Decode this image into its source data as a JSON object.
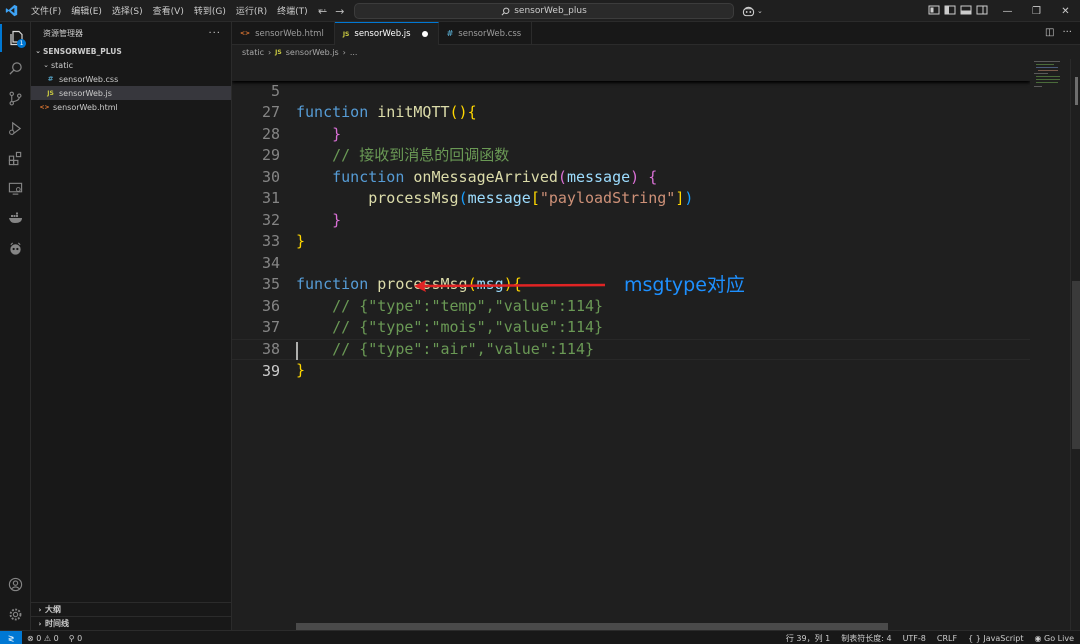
{
  "app": {
    "menu": [
      "文件(F)",
      "编辑(E)",
      "选择(S)",
      "查看(V)",
      "转到(G)",
      "运行(R)",
      "终端(T)",
      "···"
    ],
    "search_text": "sensorWeb_plus",
    "accent_color": "#0078d4"
  },
  "activity": {
    "explorer_badge": "1",
    "icons": [
      "files-icon",
      "search-icon",
      "source-control-icon",
      "run-debug-icon",
      "extensions-icon",
      "remote-explorer-icon",
      "docker-icon",
      "copilot-icon",
      "account-icon",
      "settings-gear-icon"
    ]
  },
  "sidebar": {
    "title": "资源管理器",
    "more": "···",
    "root": "SENSORWEB_PLUS",
    "folder": "static",
    "files": [
      {
        "name": "sensorWeb.css",
        "type": "css"
      },
      {
        "name": "sensorWeb.js",
        "type": "js"
      }
    ],
    "root_file": "sensorWeb.html",
    "outline_label": "大纲",
    "timeline_label": "时间线"
  },
  "tabs": [
    {
      "label": "sensorWeb.html",
      "icon": "<>"
    },
    {
      "label": "sensorWeb.js",
      "icon": "JS"
    },
    {
      "label": "sensorWeb.css",
      "icon": "#"
    }
  ],
  "breadcrumb": {
    "folder": "static",
    "file": "sensorWeb.js",
    "tail": "..."
  },
  "editor": {
    "line_numbers": [
      "5",
      "27",
      "28",
      "29",
      "30",
      "31",
      "32",
      "33",
      "34",
      "35",
      "36",
      "37",
      "38",
      "39"
    ],
    "annotation": "msgtype对应"
  },
  "status": {
    "errors": "0",
    "warnings": "0",
    "ports": "0",
    "position": "行 39，列 1",
    "tab_size": "制表符长度: 4",
    "encoding": "UTF-8",
    "eol": "CRLF",
    "language": "JavaScript",
    "golive": "Go Live"
  }
}
